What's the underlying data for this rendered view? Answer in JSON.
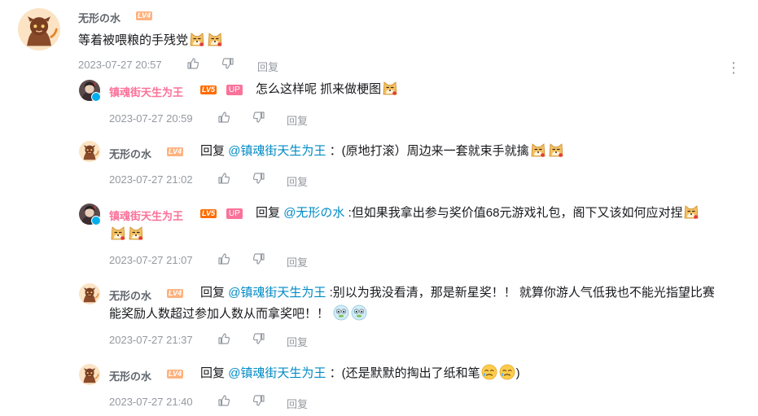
{
  "comment": {
    "user": "无形の水",
    "level": "LV4",
    "text": "等着被喂粮的手残党",
    "time": "2023-07-27 20:57",
    "reply_label": "回复"
  },
  "replies": [
    {
      "user": "镇魂街天生为王",
      "level": "LV5",
      "badge": "UP",
      "text": "怎么这样呢 抓来做梗图",
      "time": "2023-07-27 20:59",
      "reply_label": "回复"
    },
    {
      "user": "无形の水",
      "level": "LV4",
      "prefix": "回复",
      "mention": "@镇魂街天生为王",
      "text": "：(原地打滚）周边来一套就束手就擒",
      "time": "2023-07-27 21:02",
      "reply_label": "回复"
    },
    {
      "user": "镇魂街天生为王",
      "level": "LV5",
      "badge": "UP",
      "prefix": "回复",
      "mention": "@无形の水",
      "text": ":但如果我拿出参与奖价值68元游戏礼包，阁下又该如何应对捏",
      "time": "2023-07-27 21:07",
      "reply_label": "回复"
    },
    {
      "user": "无形の水",
      "level": "LV4",
      "prefix": "回复",
      "mention": "@镇魂街天生为王",
      "text": ":别以为我没看清，那是新星奖！！ 就算你游人气低我也不能光指望比赛",
      "text2": "能奖励人数超过参加人数从而拿奖吧！！",
      "time": "2023-07-27 21:37",
      "reply_label": "回复"
    },
    {
      "user": "无形の水",
      "level": "LV4",
      "prefix": "回复",
      "mention": "@镇魂街天生为王",
      "text": "：(还是默默的掏出了纸和笔",
      "text_end": ")",
      "time": "2023-07-27 21:40",
      "reply_label": "回复"
    }
  ],
  "colors": {
    "name": "#61666d",
    "up_name": "#fb7299",
    "link": "#008ac5",
    "meta": "#9499a0"
  },
  "icons": [
    "like-icon",
    "dislike-icon",
    "more-icon",
    "doge-emoji",
    "cry-emoji",
    "fish-emoji"
  ]
}
